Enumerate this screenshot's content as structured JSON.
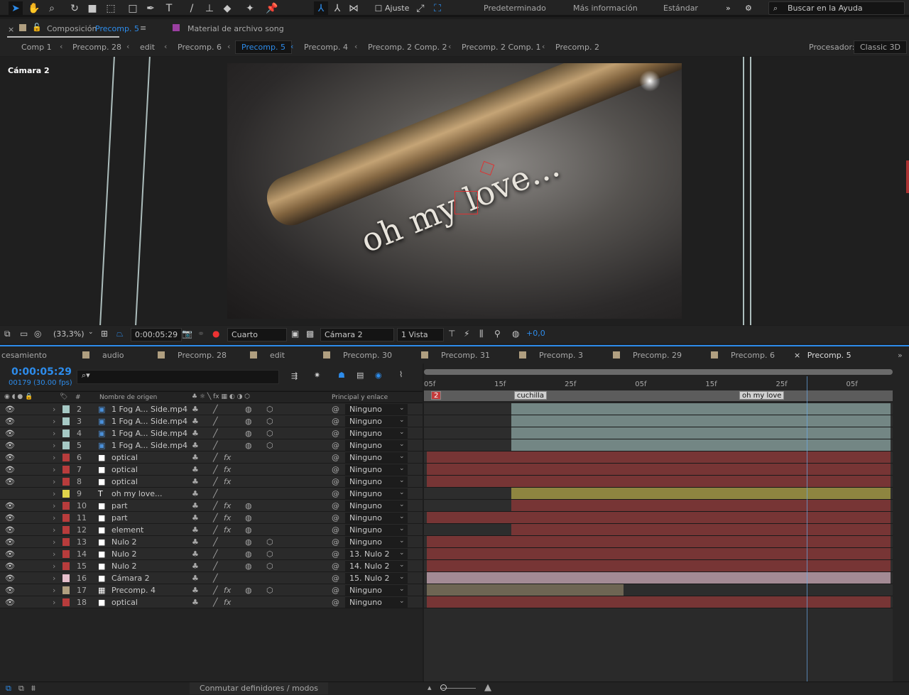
{
  "toolbar": {
    "snap_label": "Ajuste",
    "workspaces": [
      "Predeterminado",
      "Más información",
      "Estándar"
    ],
    "help_placeholder": "Buscar en la Ayuda"
  },
  "comp_tabs": {
    "active_prefix": "Composición",
    "active_name": "Precomp. 5",
    "footage_tab": "Material de archivo  song"
  },
  "breadcrumbs": [
    "Comp 1",
    "Precomp. 28",
    "edit",
    "Precomp. 6",
    "Precomp. 5",
    "Precomp. 4",
    "Precomp. 2 Comp. 2",
    "Precomp. 2 Comp. 1",
    "Precomp. 2"
  ],
  "breadcrumb_active": "Precomp. 5",
  "renderer": {
    "label": "Procesador:",
    "value": "Classic 3D"
  },
  "viewer": {
    "camera_label": "Cámara 2",
    "scene_text": "oh my love..."
  },
  "viewer_bar": {
    "zoom": "(33,3%)",
    "time": "0:00:05:29",
    "resolution": "Cuarto",
    "camera": "Cámara 2",
    "views": "1 Vista",
    "exposure": "+0,0"
  },
  "timeline_tabs": [
    "cesamiento",
    "audio",
    "Precomp. 28",
    "edit",
    "Precomp. 30",
    "Precomp. 31",
    "Precomp. 3",
    "Precomp. 29",
    "Precomp. 6",
    "Precomp. 5"
  ],
  "timeline": {
    "timecode": "0:00:05:29",
    "frames": "00179 (30.00 fps)",
    "search_placeholder": "⌕▾",
    "columns": {
      "hash": "#",
      "source": "Nombre de origen",
      "parent": "Principal y enlace"
    },
    "ruler_labels": [
      "05f",
      "15f",
      "25f",
      "05f",
      "15f",
      "25f",
      "05f"
    ],
    "view_start_frame": 125,
    "view_end_frame": 191,
    "current_frame": 179,
    "markers": [
      {
        "label": "2",
        "frame": 125,
        "color": "#c23b3b"
      },
      {
        "label": "cuchilla",
        "frame": 137
      },
      {
        "label": "oh my love",
        "frame": 169
      }
    ]
  },
  "layers": [
    {
      "num": "2",
      "name": "1 Fog A... Side.mp4",
      "type": "video",
      "color": "#a6c9c5",
      "bar": "#738684",
      "parent": "Ninguno",
      "in": 137,
      "out": 191,
      "fx": false
    },
    {
      "num": "3",
      "name": "1 Fog A... Side.mp4",
      "type": "video",
      "color": "#a6c9c5",
      "bar": "#738684",
      "parent": "Ninguno",
      "in": 137,
      "out": 191,
      "fx": false
    },
    {
      "num": "4",
      "name": "1 Fog A... Side.mp4",
      "type": "video",
      "color": "#a6c9c5",
      "bar": "#738684",
      "parent": "Ninguno",
      "in": 137,
      "out": 191,
      "fx": false
    },
    {
      "num": "5",
      "name": "1 Fog A... Side.mp4",
      "type": "video",
      "color": "#a6c9c5",
      "bar": "#738684",
      "parent": "Ninguno",
      "in": 137,
      "out": 191,
      "fx": false
    },
    {
      "num": "6",
      "name": "optical",
      "type": "solid",
      "color": "#b83c3c",
      "bar": "#773535",
      "parent": "Ninguno",
      "in": 125,
      "out": 191,
      "fx": true
    },
    {
      "num": "7",
      "name": "optical",
      "type": "solid",
      "color": "#b83c3c",
      "bar": "#773535",
      "parent": "Ninguno",
      "in": 125,
      "out": 191,
      "fx": true
    },
    {
      "num": "8",
      "name": "optical",
      "type": "solid",
      "color": "#b83c3c",
      "bar": "#773535",
      "parent": "Ninguno",
      "in": 125,
      "out": 191,
      "fx": true
    },
    {
      "num": "9",
      "name": "oh my love...",
      "type": "text",
      "color": "#e0d44b",
      "bar": "#8e8540",
      "parent": "Ninguno",
      "in": 137,
      "out": 191,
      "fx": false
    },
    {
      "num": "10",
      "name": "part",
      "type": "solid",
      "color": "#b83c3c",
      "bar": "#773535",
      "parent": "Ninguno",
      "in": 137,
      "out": 191,
      "fx": true
    },
    {
      "num": "11",
      "name": "part",
      "type": "solid",
      "color": "#b83c3c",
      "bar": "#773535",
      "parent": "Ninguno",
      "in": 125,
      "out": 191,
      "fx": true
    },
    {
      "num": "12",
      "name": "element",
      "type": "solid",
      "color": "#b83c3c",
      "bar": "#773535",
      "parent": "Ninguno",
      "in": 137,
      "out": 191,
      "fx": true
    },
    {
      "num": "13",
      "name": "Nulo 2",
      "type": "solid",
      "color": "#b83c3c",
      "bar": "#773535",
      "parent": "Ninguno",
      "in": 125,
      "out": 191,
      "fx": false
    },
    {
      "num": "14",
      "name": "Nulo 2",
      "type": "solid",
      "color": "#b83c3c",
      "bar": "#773535",
      "parent": "13. Nulo 2",
      "in": 125,
      "out": 191,
      "fx": false
    },
    {
      "num": "15",
      "name": "Nulo 2",
      "type": "solid",
      "color": "#b83c3c",
      "bar": "#773535",
      "parent": "14. Nulo 2",
      "in": 125,
      "out": 191,
      "fx": false
    },
    {
      "num": "16",
      "name": "Cámara 2",
      "type": "camera",
      "color": "#e6bfcc",
      "bar": "#a38a94",
      "parent": "15. Nulo 2",
      "in": 125,
      "out": 191,
      "fx": false
    },
    {
      "num": "17",
      "name": "Precomp. 4",
      "type": "comp",
      "color": "#b09f80",
      "bar": "#6e6553",
      "parent": "Ninguno",
      "in": 125,
      "out": 153,
      "fx": true
    },
    {
      "num": "18",
      "name": "optical",
      "type": "solid",
      "color": "#b83c3c",
      "bar": "#773535",
      "parent": "Ninguno",
      "in": 125,
      "out": 191,
      "fx": true
    }
  ],
  "footer": {
    "toggle_label": "Conmutar definidores / modos"
  },
  "colors": {
    "accent": "#2d8ceb"
  }
}
